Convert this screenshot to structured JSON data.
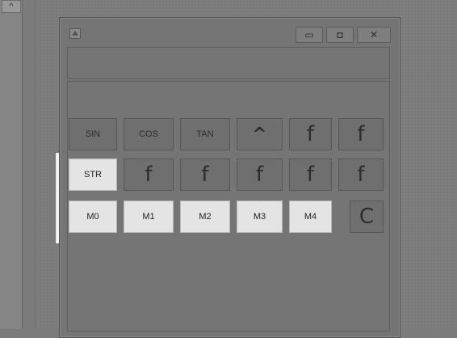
{
  "gutter": {
    "scroll_up_icon": "chevron-up-icon",
    "scroll_up_glyph": "^"
  },
  "window": {
    "icon": "app-calculator-icon",
    "buttons": {
      "minimize": "▭",
      "maximize": "◘",
      "close": "✕"
    }
  },
  "keys": {
    "row1": [
      "SIN",
      "COS",
      "TAN",
      "^",
      "f",
      "f"
    ],
    "row2": [
      "STR",
      "f",
      "f",
      "f",
      "f",
      "f"
    ],
    "row3": [
      "M0",
      "M1",
      "M2",
      "M3",
      "M4",
      "C"
    ]
  },
  "colors": {
    "highlight": "#f4f4f4",
    "background": "#7b7b7b"
  }
}
